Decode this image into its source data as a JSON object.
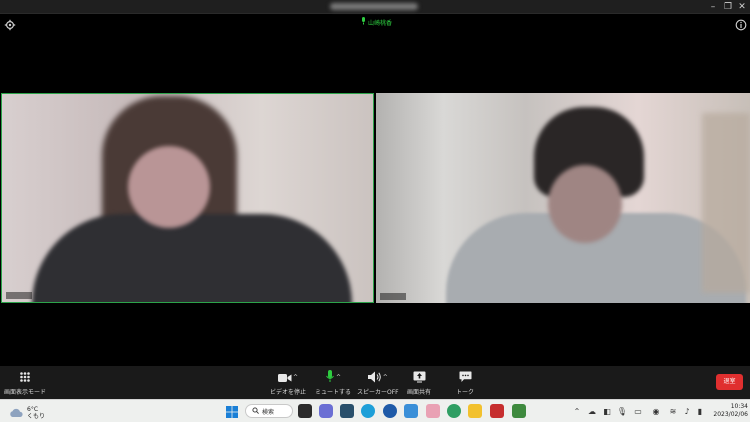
{
  "window": {
    "title_blurred": true,
    "controls": [
      "–",
      "❐",
      "✕"
    ]
  },
  "top_bar": {
    "active_speaker": "山崎桃香",
    "settings_icon": "gear-icon",
    "info_icon": "info-icon"
  },
  "participants": [
    {
      "tile": "left",
      "active_speaker": true,
      "face_blurred": true
    },
    {
      "tile": "right",
      "active_speaker": false,
      "face_blurred": true
    }
  ],
  "toolbar": {
    "view_mode_label": "画面表示モード",
    "video_label": "ビデオを停止",
    "mute_label": "ミュートする",
    "speaker_label": "スピーカーOFF",
    "share_label": "画面共有",
    "chat_label": "トーク",
    "end_label": "退室",
    "caret": "^"
  },
  "taskbar": {
    "weather": {
      "temp": "6°C",
      "condition": "くもり"
    },
    "search_label": "検索",
    "clock": {
      "time": "10:34",
      "date": "2023/02/06"
    }
  },
  "colors": {
    "active_speaker_border": "#2ca34a",
    "mic_green": "#2ecc40",
    "end_button": "#e02f2f",
    "toolbar_bg": "#1a1a1a",
    "taskbar_bg": "#eef0ee"
  }
}
